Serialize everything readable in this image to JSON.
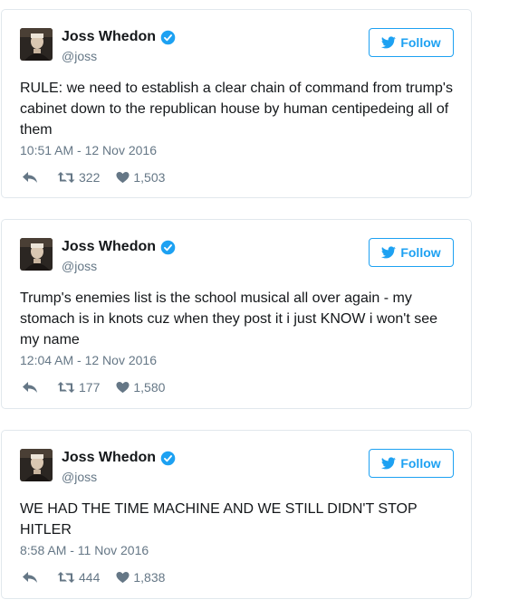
{
  "tweets": [
    {
      "name": "Joss Whedon",
      "handle": "@joss",
      "follow_label": "Follow",
      "text": "RULE: we need to establish a clear chain of command from trump's cabinet down to the republican house by human centipedeing all of them",
      "timestamp": "10:51 AM - 12 Nov 2016",
      "retweets": "322",
      "likes": "1,503"
    },
    {
      "name": "Joss Whedon",
      "handle": "@joss",
      "follow_label": "Follow",
      "text": "Trump's enemies list is the school musical all over again - my stomach is in knots cuz when they post it i just KNOW i won't see my name",
      "timestamp": "12:04 AM - 12 Nov 2016",
      "retweets": "177",
      "likes": "1,580"
    },
    {
      "name": "Joss Whedon",
      "handle": "@joss",
      "follow_label": "Follow",
      "text": "WE HAD THE TIME MACHINE AND WE STILL DIDN'T STOP HITLER",
      "timestamp": "8:58 AM - 11 Nov 2016",
      "retweets": "444",
      "likes": "1,838"
    }
  ],
  "icons": {
    "verified": "verified-badge-icon",
    "follow": "twitter-bird-icon",
    "reply": "reply-icon",
    "retweet": "retweet-icon",
    "like": "heart-icon"
  },
  "colors": {
    "brand_blue": "#1da1f2",
    "muted_text": "#657786",
    "border": "#e1e8ed",
    "main_text": "#14171a"
  }
}
